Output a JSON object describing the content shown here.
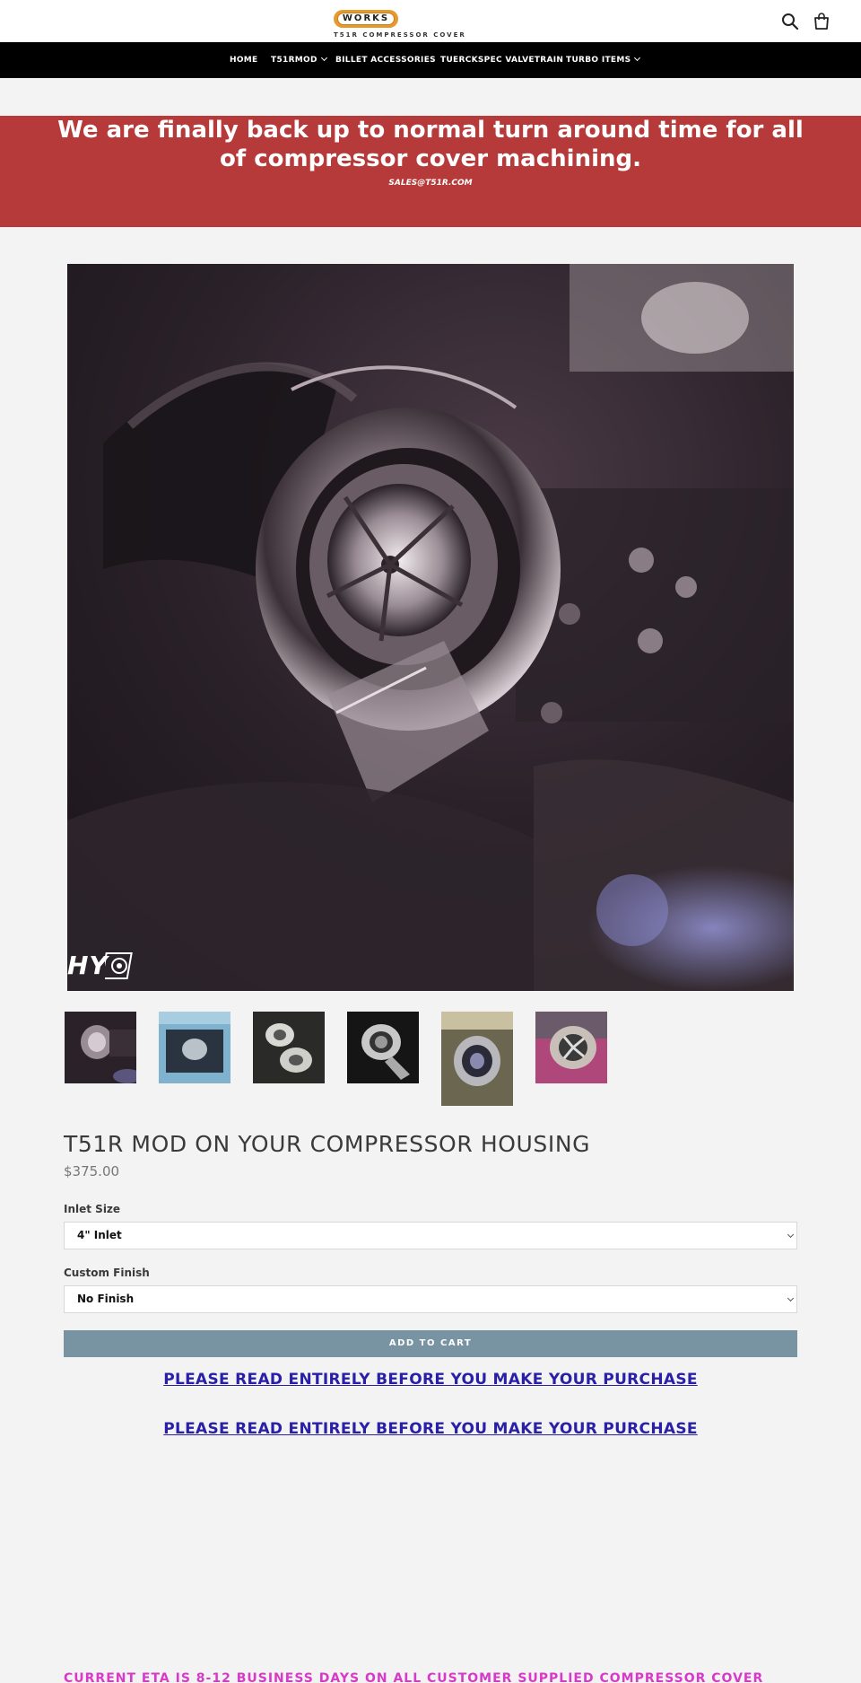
{
  "header": {
    "logo_text": "WORKS",
    "logo_subtitle": "T51R COMPRESSOR COVER",
    "search_icon": "search-icon",
    "cart_icon": "bag-icon"
  },
  "nav": {
    "items": [
      {
        "label": "HOME",
        "dropdown": false
      },
      {
        "label": "T51RMOD",
        "dropdown": true
      },
      {
        "label": "BILLET ACCESSORIES",
        "dropdown": false
      },
      {
        "label": "TUERCKSPEC VALVETRAIN",
        "dropdown": false
      },
      {
        "label": "TURBO ITEMS",
        "dropdown": true
      }
    ]
  },
  "announcement": {
    "title": "We are finally back up to normal turn around time for all of compressor cover machining.",
    "email": "SALES@T51R.COM",
    "background": "#b73a3a"
  },
  "product": {
    "image_watermark": "HY",
    "thumbnails": [
      {
        "alt": "turbo in engine bay"
      },
      {
        "alt": "engine bay blue"
      },
      {
        "alt": "two compressor housings"
      },
      {
        "alt": "compressor housing studio"
      },
      {
        "alt": "compressor cover closeup"
      },
      {
        "alt": "compressor wheel"
      }
    ],
    "title": "T51R MOD ON YOUR COMPRESSOR HOUSING",
    "price": "$375.00",
    "options": [
      {
        "label": "Inlet Size",
        "value": "4\" Inlet"
      },
      {
        "label": "Custom Finish",
        "value": "No Finish"
      }
    ],
    "add_to_cart": "ADD TO CART",
    "button_color": "#7894a3"
  },
  "description": {
    "read_notice_1": "PLEASE READ ENTIRELY BEFORE YOU MAKE YOUR PURCHASE",
    "read_notice_2": "PLEASE READ ENTIRELY BEFORE YOU MAKE YOUR PURCHASE",
    "eta": "CURRENT ETA IS 8-12 BUSINESS DAYS ON ALL CUSTOMER SUPPLIED COMPRESSOR COVER",
    "eta_color": "#d63ac8",
    "link_color": "#2a20a8"
  }
}
